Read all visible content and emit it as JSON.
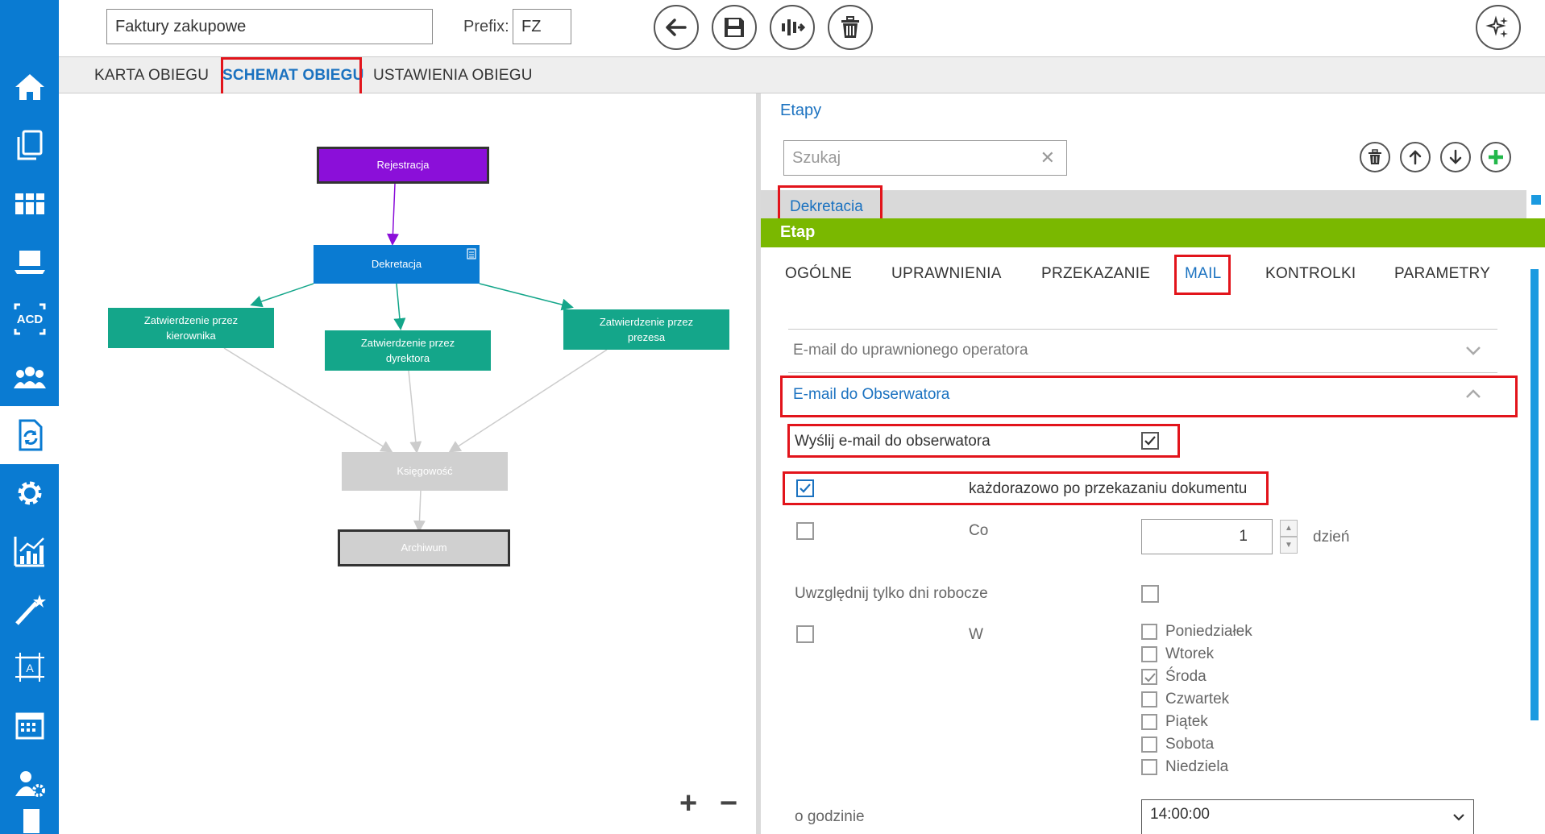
{
  "toolbar": {
    "name_value": "Faktury zakupowe",
    "prefix_label": "Prefix:",
    "prefix_value": "FZ",
    "buttons": [
      "back-icon",
      "save-icon",
      "workflow-icon",
      "delete-icon",
      "magic-icon"
    ]
  },
  "tabs": [
    "KARTA OBIEGU",
    "SCHEMAT OBIEGU",
    "USTAWIENIA OBIEGU"
  ],
  "active_tab": "SCHEMAT OBIEGU",
  "diagram": {
    "nodes": {
      "rejestracja": "Rejestracja",
      "dekretacja": "Dekretacja",
      "kierownik_1": "Zatwierdzenie przez",
      "kierownik_2": "kierownika",
      "dyrektor_1": "Zatwierdzenie przez",
      "dyrektor_2": "dyrektora",
      "prezes_1": "Zatwierdzenie przez",
      "prezes_2": "prezesa",
      "ksiegowosc": "Księgowość",
      "archiwum": "Archiwum"
    },
    "zoom_in": "+",
    "zoom_out": "−"
  },
  "right_panel": {
    "title": "Etapy",
    "search_placeholder": "Szukaj",
    "selected_stage": "Dekretacia",
    "etap_label": "Etap",
    "subtabs": [
      "OGÓLNE",
      "UPRAWNIENIA",
      "PRZEKAZANIE",
      "MAIL",
      "KONTROLKI",
      "PARAMETRY"
    ],
    "active_subtab": "MAIL",
    "section_operator": "E-mail do uprawnionego operatora",
    "section_observer": "E-mail do Obserwatora",
    "send_email_label": "Wyślij e-mail do obserwatora",
    "send_email_checked": true,
    "each_time_label": "każdorazowo po przekazaniu dokumentu",
    "each_time_checked": true,
    "co_label": "Co",
    "co_value": "1",
    "day_label": "dzień",
    "workdays_label": "Uwzględnij tylko dni robocze",
    "w_label": "W",
    "days": [
      {
        "name": "Poniedziałek",
        "checked": false
      },
      {
        "name": "Wtorek",
        "checked": false
      },
      {
        "name": "Środa",
        "checked": true
      },
      {
        "name": "Czwartek",
        "checked": false
      },
      {
        "name": "Piątek",
        "checked": false
      },
      {
        "name": "Sobota",
        "checked": false
      },
      {
        "name": "Niedziela",
        "checked": false
      }
    ],
    "hour_label": "o godzinie",
    "hour_value": "14:00:00"
  },
  "colors": {
    "sidebar": "#0a7bd2",
    "accent_blue": "#1b72c0",
    "etap_green": "#7ab800",
    "highlight_red": "#e2141b",
    "node_purple": "#8b0fd9",
    "node_teal": "#14a68a",
    "node_gray": "#d0d0d0"
  }
}
